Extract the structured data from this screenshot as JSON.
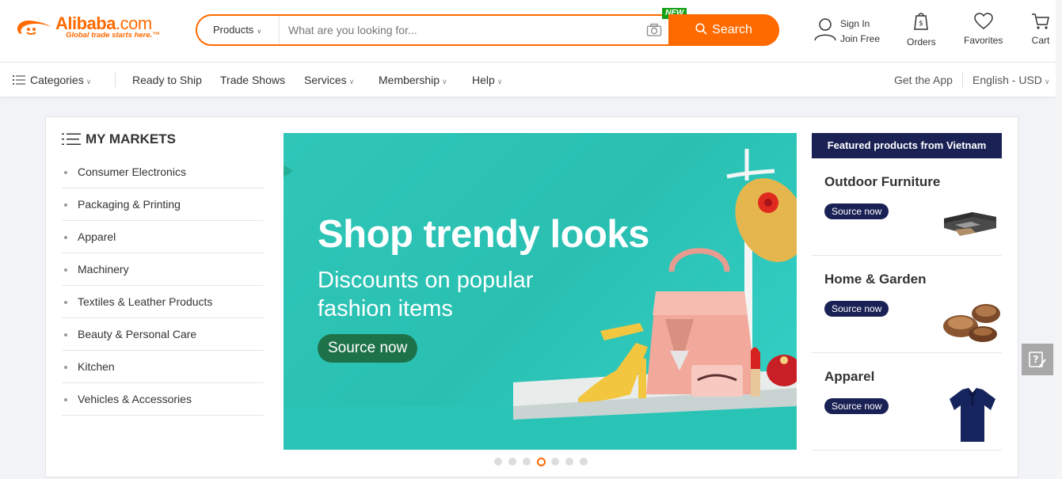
{
  "header": {
    "logo_text": "Alibaba",
    "logo_domain": ".com",
    "logo_tagline": "Global trade starts here.™",
    "search": {
      "category": "Products",
      "placeholder": "What are you looking for...",
      "new_badge": "NEW",
      "button_label": "Search"
    },
    "signin": "Sign In",
    "join": "Join Free",
    "orders": "Orders",
    "favorites": "Favorites",
    "cart": "Cart"
  },
  "nav": {
    "categories": "Categories",
    "items": [
      "Ready to Ship",
      "Trade Shows",
      "Services",
      "Membership",
      "Help"
    ],
    "get_app": "Get the App",
    "language_currency": "English - USD"
  },
  "markets": {
    "title": "MY MARKETS",
    "items": [
      "Consumer Electronics",
      "Packaging & Printing",
      "Apparel",
      "Machinery",
      "Textiles & Leather Products",
      "Beauty & Personal Care",
      "Kitchen",
      "Vehicles & Accessories"
    ]
  },
  "banner": {
    "title": "Shop trendy looks",
    "subtitle": "Discounts on popular fashion items",
    "button": "Source now",
    "active_slide": 4,
    "slide_count": 7
  },
  "featured": {
    "header": "Featured products from Vietnam",
    "cards": [
      {
        "name": "Outdoor Furniture",
        "button": "Source now"
      },
      {
        "name": "Home & Garden",
        "button": "Source now"
      },
      {
        "name": "Apparel",
        "button": "Source now"
      }
    ]
  },
  "colors": {
    "brand_orange": "#ff6a00",
    "navy": "#1a2155",
    "banner_teal": "#2fc6b8",
    "banner_button_green": "#1e7249"
  }
}
